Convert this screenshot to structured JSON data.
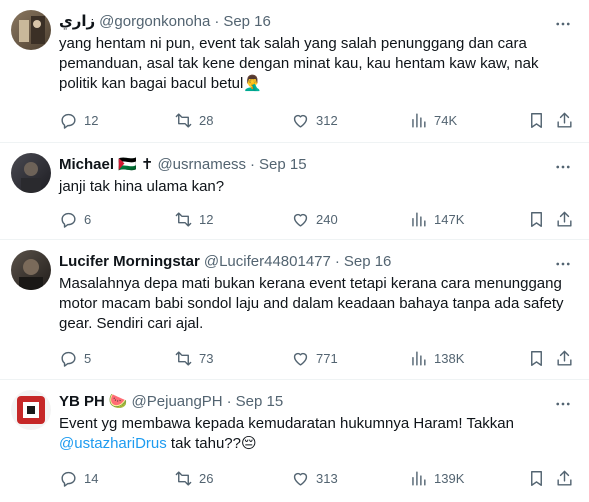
{
  "tweets": [
    {
      "name": "زاري",
      "badge": "",
      "handle": "@gorgonkonoha",
      "date": "Sep 16",
      "text": "yang hentam ni pun, event tak salah yang salah penunggang dan cara pemanduan, asal tak kene dengan minat kau, kau hentam kaw kaw, nak politik kan bagai bacul betul🤦‍♂️",
      "replies": "12",
      "retweets": "28",
      "likes": "312",
      "views": "74K",
      "avatar_color": "#6b5a44"
    },
    {
      "name": "Michael",
      "badge": "🇵🇸 ✝",
      "handle": "@usrnamess",
      "date": "Sep 15",
      "text": "janji tak hina ulama kan?",
      "replies": "6",
      "retweets": "12",
      "likes": "240",
      "views": "147K",
      "avatar_color": "#2c2c30"
    },
    {
      "name": "Lucifer Morningstar",
      "badge": "",
      "handle": "@Lucifer44801477",
      "date": "Sep 16",
      "text": "Masalahnya depa mati bukan kerana event tetapi kerana cara menunggang motor macam babi sondol laju and dalam keadaan bahaya tanpa ada safety gear. Sendiri cari ajal.",
      "replies": "5",
      "retweets": "73",
      "likes": "771",
      "views": "138K",
      "avatar_color": "#3f3a35"
    },
    {
      "name": "YB PH",
      "badge": "🍉",
      "handle": "@PejuangPH",
      "date": "Sep 15",
      "text_before": "Event yg membawa kepada kemudaratan hukumnya Haram! Takkan ",
      "mention": "@ustazhariDrus",
      "text_after": " tak tahu??😔",
      "replies": "14",
      "retweets": "26",
      "likes": "313",
      "views": "139K",
      "avatar_color": "#c62828"
    }
  ],
  "icons": {
    "more": "more-options-icon",
    "reply": "reply-icon",
    "retweet": "retweet-icon",
    "like": "heart-icon",
    "views": "analytics-icon",
    "bookmark": "bookmark-icon",
    "share": "share-icon"
  },
  "colors": {
    "text": "#0f1419",
    "secondary": "#536471",
    "link": "#1d9bf0",
    "divider": "#eff3f4"
  }
}
